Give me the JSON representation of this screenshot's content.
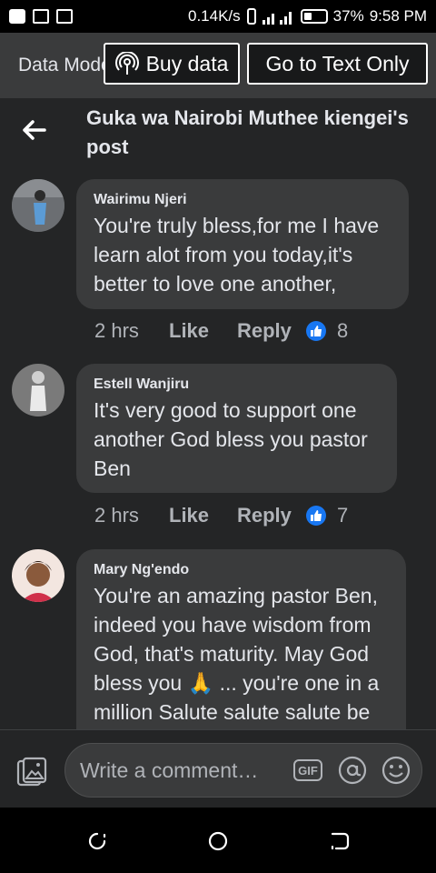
{
  "status_bar": {
    "speed": "0.14K/s",
    "battery": "37%",
    "time": "9:58 PM"
  },
  "data_bar": {
    "label": "Data Mode",
    "buy_data": "Buy data",
    "text_only": "Go to Text Only"
  },
  "header": {
    "title": "Guka wa Nairobi Muthee kiengei's post"
  },
  "comments": [
    {
      "author": "Wairimu Njeri",
      "text": "You're truly bless,for me I have learn alot from you today,it's better to love one another,",
      "time": "2 hrs",
      "like": "Like",
      "reply": "Reply",
      "reactions": "8"
    },
    {
      "author": "Estell Wanjiru",
      "text": "It's very good to support one another God bless you pastor Ben",
      "time": "2 hrs",
      "like": "Like",
      "reply": "Reply",
      "reactions": "7"
    },
    {
      "author": "Mary Ng'endo",
      "text": "You're an amazing pastor Ben, indeed you have wisdom from God, that's maturity. May God bless you 🙏 ... you're one in a million Salute salute salute be"
    }
  ],
  "composer": {
    "placeholder": "Write a comment…",
    "gif": "GIF"
  },
  "colors": {
    "background": "#242526",
    "bubble": "#3a3b3c",
    "like_blue": "#1877f2"
  }
}
